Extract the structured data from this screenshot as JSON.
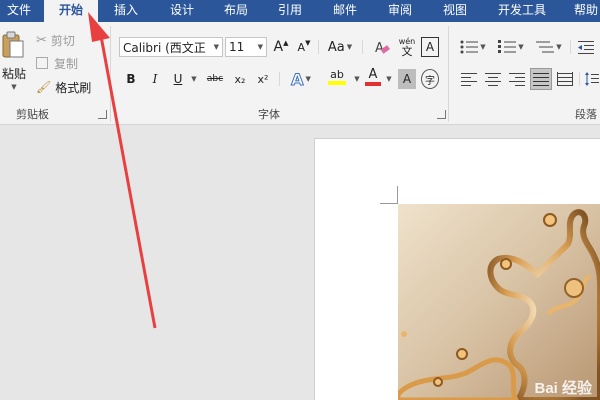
{
  "tabs": [
    {
      "label": "文件",
      "active": false
    },
    {
      "label": "开始",
      "active": true
    },
    {
      "label": "插入",
      "active": false
    },
    {
      "label": "设计",
      "active": false
    },
    {
      "label": "布局",
      "active": false
    },
    {
      "label": "引用",
      "active": false
    },
    {
      "label": "邮件",
      "active": false
    },
    {
      "label": "审阅",
      "active": false
    },
    {
      "label": "视图",
      "active": false
    },
    {
      "label": "开发工具",
      "active": false
    },
    {
      "label": "帮助",
      "active": false
    }
  ],
  "clipboard": {
    "paste_label": "粘贴",
    "cut_label": "剪切",
    "copy_label": "复制",
    "format_painter_label": "格式刷",
    "group_label": "剪贴板"
  },
  "font": {
    "font_name": "Calibri (西文正",
    "font_size": "11",
    "grow_label": "A",
    "shrink_label": "A",
    "case_label": "Aa",
    "phonetic_label": "wén",
    "phonetic_char": "文",
    "border_char_label": "A",
    "bold_label": "B",
    "italic_label": "I",
    "underline_label": "U",
    "strike_label": "abc",
    "subscript_label": "x₂",
    "superscript_label": "x²",
    "effects_label": "A",
    "highlight_label": "ab",
    "font_color_label": "A",
    "shading_label": "A",
    "enclose_label": "字",
    "group_label": "字体",
    "highlight_color": "#ffff00",
    "font_color": "#e03030"
  },
  "paragraph": {
    "group_label": "段落"
  },
  "document": {
    "watermark": "Bai 经验"
  },
  "colors": {
    "tab_bar": "#2b579a",
    "ribbon_bg": "#f3f3f3",
    "annotation_arrow": "#e84040"
  }
}
